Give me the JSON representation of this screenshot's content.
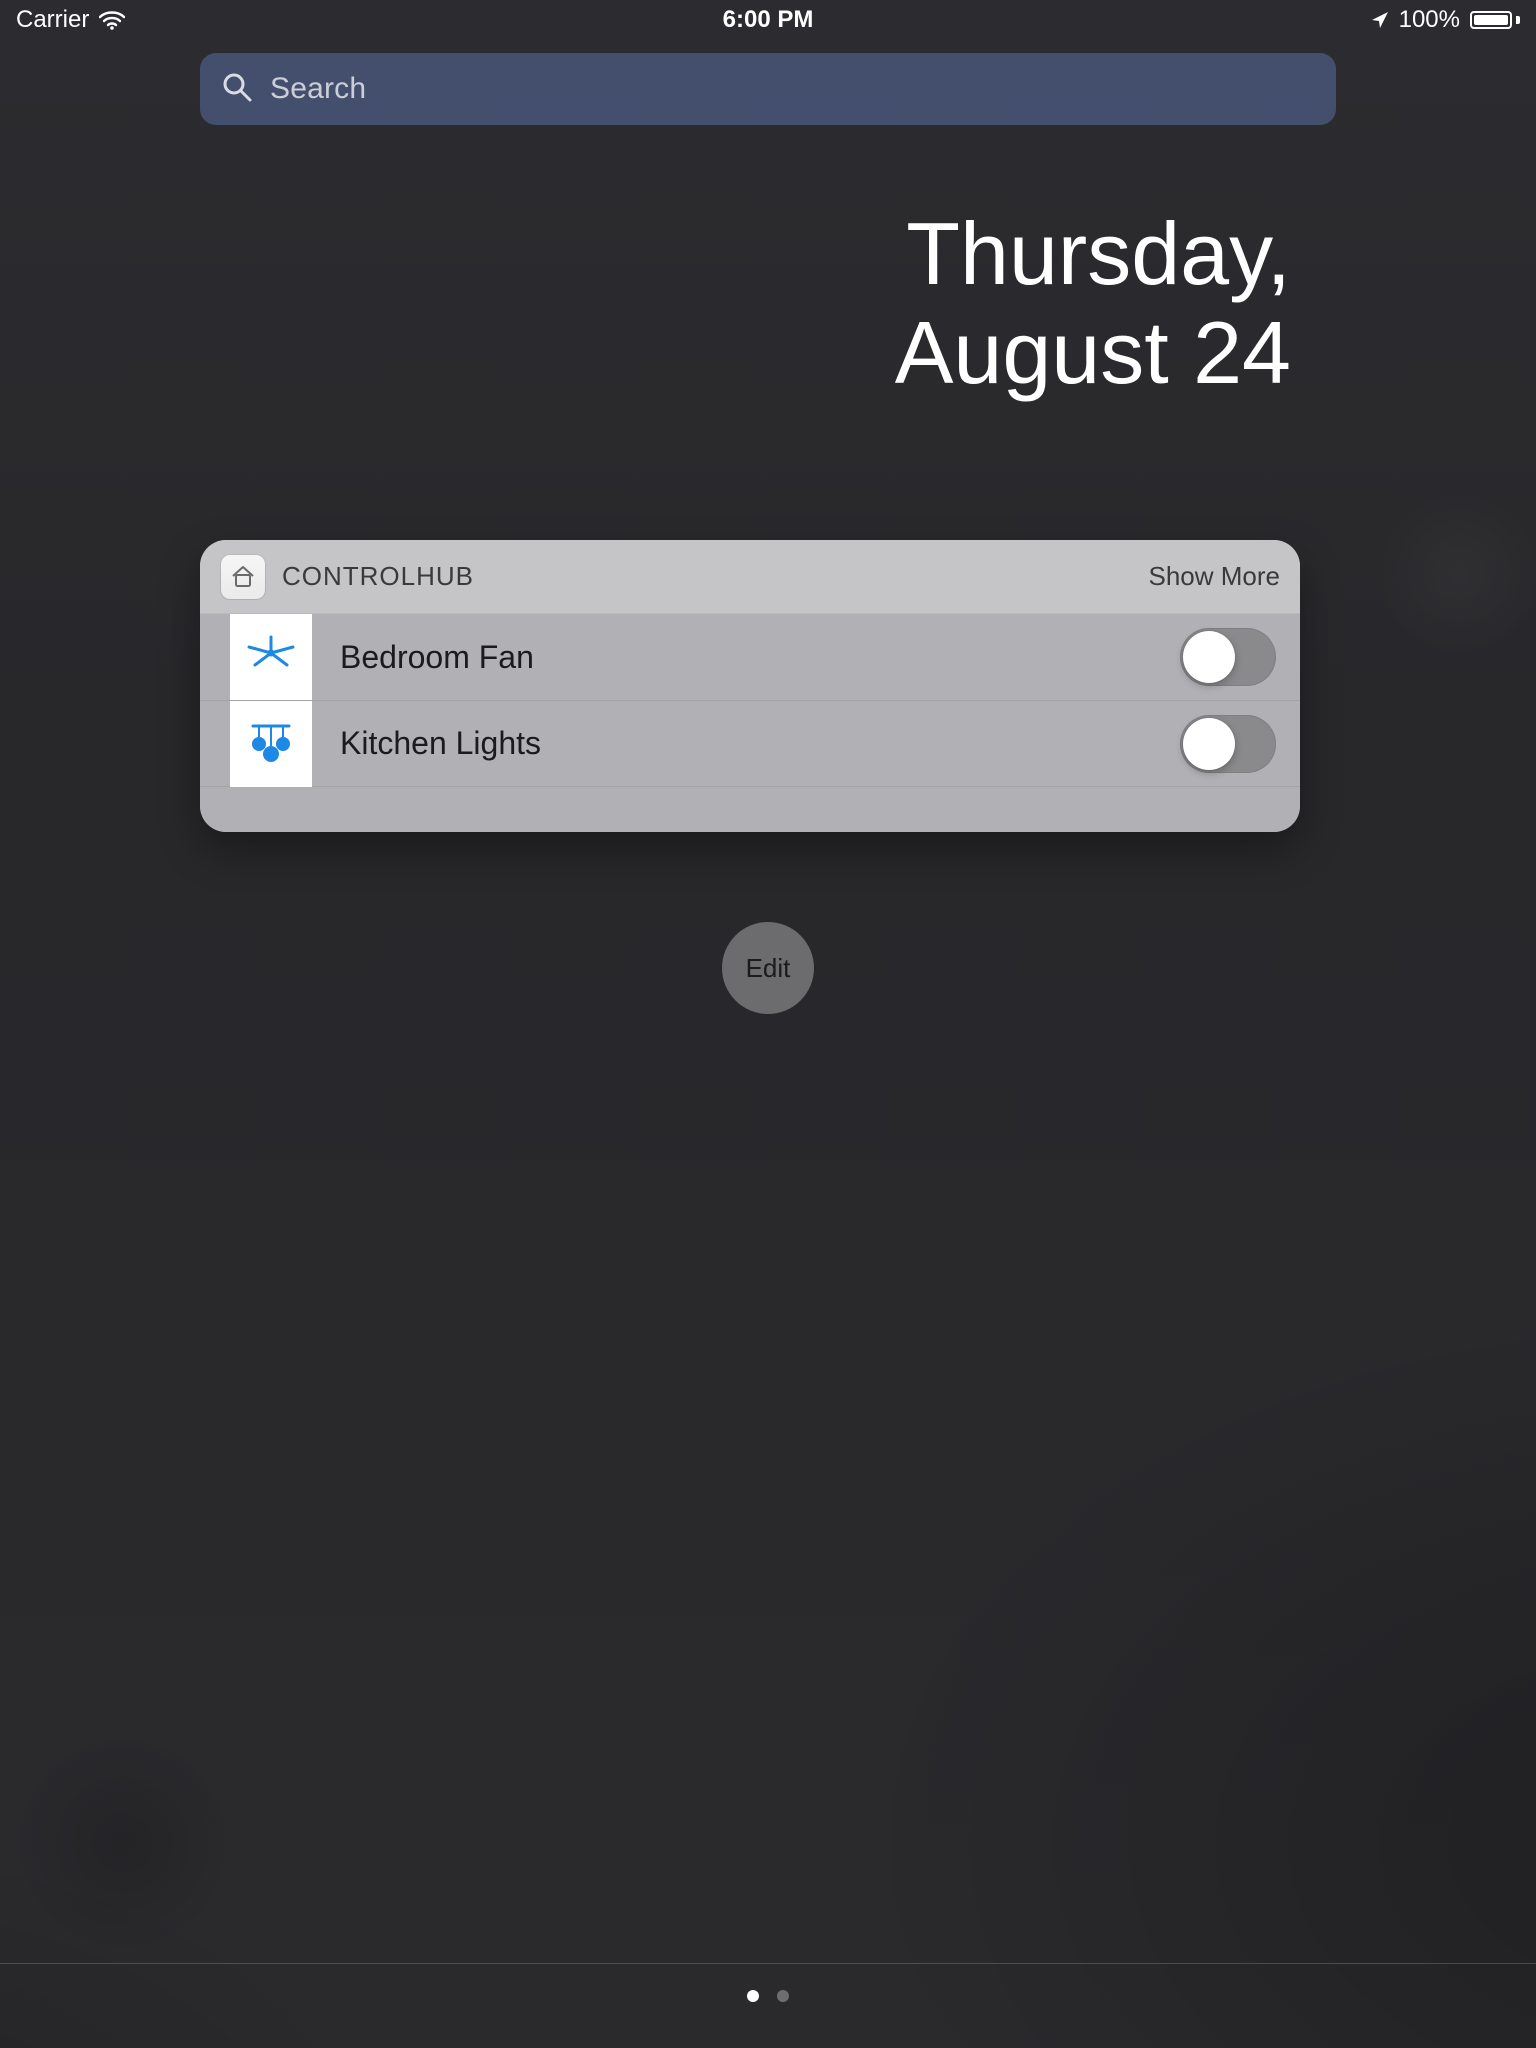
{
  "status": {
    "carrier": "Carrier",
    "time": "6:00 PM",
    "battery_pct": "100%"
  },
  "search": {
    "placeholder": "Search"
  },
  "date": {
    "line1": "Thursday,",
    "line2": "August 24"
  },
  "widget": {
    "title": "CONTROLHUB",
    "show_more": "Show More",
    "items": [
      {
        "label": "Bedroom Fan",
        "icon": "fan",
        "on": false
      },
      {
        "label": "Kitchen Lights",
        "icon": "lights",
        "on": false
      }
    ]
  },
  "edit_label": "Edit",
  "pages": {
    "count": 2,
    "active_index": 0
  }
}
